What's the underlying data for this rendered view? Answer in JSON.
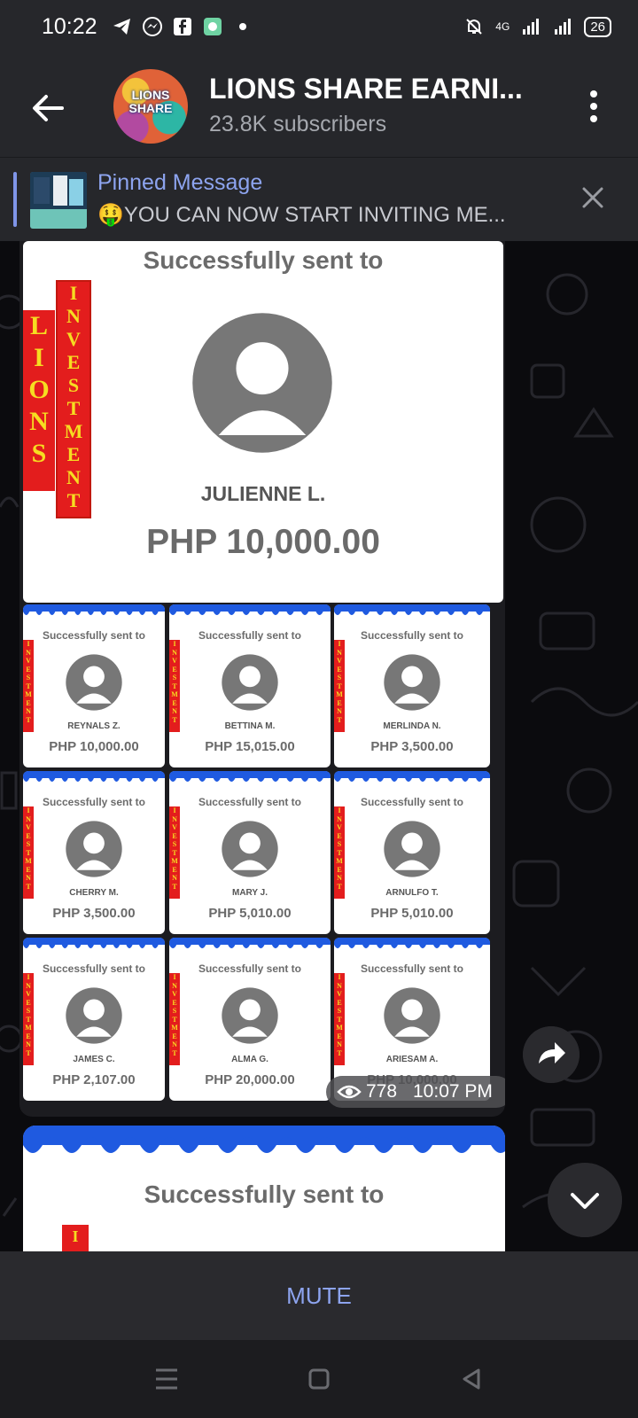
{
  "status_bar": {
    "time": "10:22",
    "network": "4G",
    "battery": "26"
  },
  "header": {
    "channel_title": "LIONS SHARE EARNI...",
    "subscribers": "23.8K subscribers",
    "avatar_text": "LIONS SHARE"
  },
  "pinned": {
    "label": "Pinned Message",
    "text": "🤑YOU CAN NOW START INVITING ME..."
  },
  "album": {
    "sent_label": "Successfully sent to",
    "badge_outer": "LIONS",
    "badge_inner": "INVESTMENT",
    "featured": {
      "name": "JULIENNE L.",
      "amount": "PHP 10,000.00"
    },
    "tiles": [
      {
        "name": "REYNALS Z.",
        "amount": "PHP 10,000.00"
      },
      {
        "name": "BETTINA M.",
        "amount": "PHP 15,015.00"
      },
      {
        "name": "MERLINDA N.",
        "amount": "PHP 3,500.00"
      },
      {
        "name": "CHERRY M.",
        "amount": "PHP 3,500.00"
      },
      {
        "name": "MARY J.",
        "amount": "PHP 5,010.00"
      },
      {
        "name": "ARNULFO T.",
        "amount": "PHP 5,010.00"
      },
      {
        "name": "JAMES C.",
        "amount": "PHP 2,107.00"
      },
      {
        "name": "ALMA G.",
        "amount": "PHP 20,000.00"
      },
      {
        "name": "ARIESAM A.",
        "amount": "PHP 10,000.00"
      }
    ],
    "views": "778",
    "time": "10:07 PM"
  },
  "next_message": {
    "sent_label": "Successfully sent to"
  },
  "mute_label": "MUTE",
  "colors": {
    "accent": "#8da4ef",
    "badge_red": "#e31d1d",
    "badge_yellow": "#f6dd21",
    "wave_blue": "#1f5ae0"
  }
}
